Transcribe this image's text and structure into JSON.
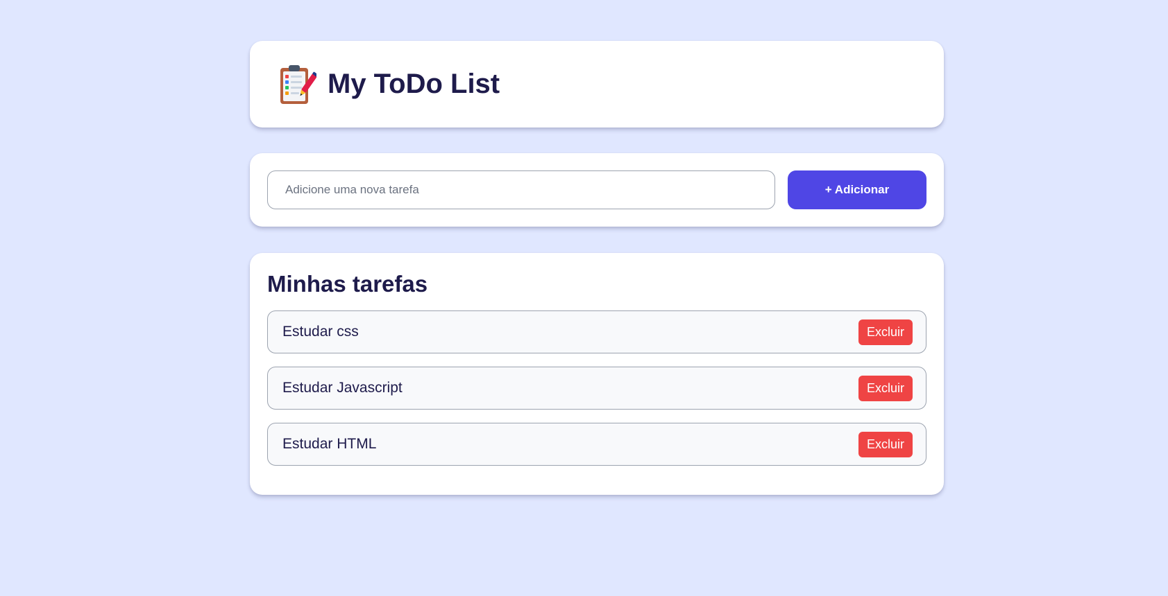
{
  "header": {
    "icon": "clipboard-checklist-icon",
    "title": "My ToDo List"
  },
  "add_form": {
    "input_value": "",
    "placeholder": "Adicione uma nova tarefa",
    "button_label": "+ Adicionar"
  },
  "tasks_section": {
    "title": "Minhas tarefas",
    "items": [
      {
        "text": "Estudar css",
        "delete_label": "Excluir"
      },
      {
        "text": "Estudar Javascript",
        "delete_label": "Excluir"
      },
      {
        "text": "Estudar HTML",
        "delete_label": "Excluir"
      }
    ]
  },
  "colors": {
    "background": "#e0e7ff",
    "primary": "#4f46e5",
    "danger": "#ef4444",
    "text": "#1e1b4b"
  }
}
